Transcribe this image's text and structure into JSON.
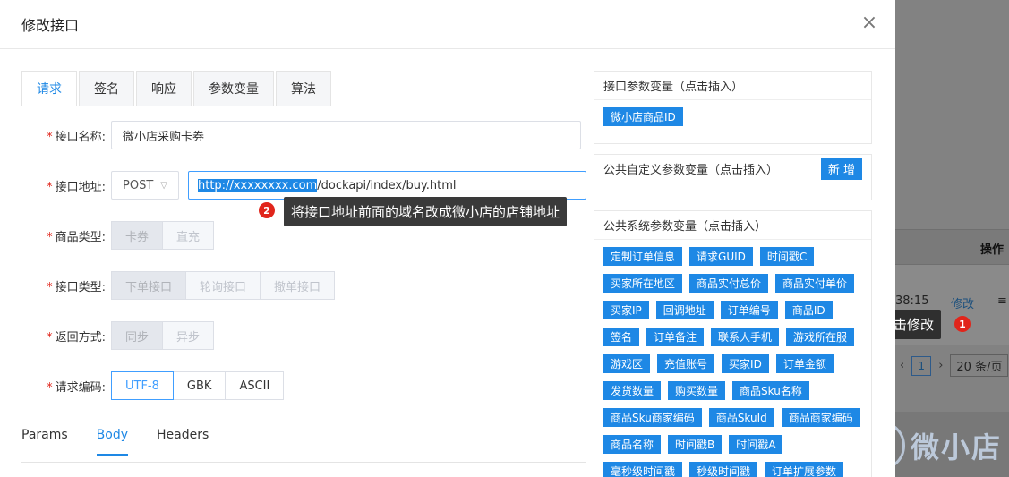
{
  "dialog": {
    "title": "修改接口",
    "close_icon": "×"
  },
  "tabs": [
    {
      "label": "请求",
      "active": true
    },
    {
      "label": "签名"
    },
    {
      "label": "响应"
    },
    {
      "label": "参数变量"
    },
    {
      "label": "算法"
    }
  ],
  "form": {
    "name": {
      "label": "接口名称:",
      "value": "微小店采购卡券"
    },
    "url": {
      "label": "接口地址:",
      "method": "POST",
      "domain": "http://xxxxxxxx.com",
      "path": "/dockapi/index/buy.html"
    },
    "goods_type": {
      "label": "商品类型:",
      "options": [
        "卡券",
        "直充"
      ]
    },
    "api_type": {
      "label": "接口类型:",
      "options": [
        "下单接口",
        "轮询接口",
        "撤单接口"
      ]
    },
    "return_mode": {
      "label": "返回方式:",
      "options": [
        "同步",
        "异步"
      ]
    },
    "encoding": {
      "label": "请求编码:",
      "options": [
        "UTF-8",
        "GBK",
        "ASCII"
      ]
    }
  },
  "subtabs": [
    {
      "label": "Params"
    },
    {
      "label": "Body",
      "active": true
    },
    {
      "label": "Headers"
    }
  ],
  "hint2": {
    "badge": "2",
    "text": "将接口地址前面的域名改成微小店的店铺地址"
  },
  "hint1": {
    "badge": "1",
    "text": "点击修改"
  },
  "panels": {
    "interface_params": {
      "title": "接口参数变量（点击插入）",
      "chips": [
        "微小店商品ID"
      ]
    },
    "public_custom": {
      "title": "公共自定义参数变量（点击插入）",
      "add_label": "新 增"
    },
    "public_system": {
      "title": "公共系统参数变量（点击插入）",
      "chips": [
        "定制订单信息",
        "请求GUID",
        "时间戳C",
        "买家所在地区",
        "商品实付总价",
        "商品实付单价",
        "买家IP",
        "回调地址",
        "订单编号",
        "商品ID",
        "签名",
        "订单备注",
        "联系人手机",
        "游戏所在服",
        "游戏区",
        "充值账号",
        "买家ID",
        "订单金额",
        "发货数量",
        "购买数量",
        "商品Sku名称",
        "商品Sku商家编码",
        "商品SkuId",
        "商品商家编码",
        "商品名称",
        "时间戳B",
        "时间戳A",
        "毫秒级时间戳",
        "秒级时间戳",
        "订单扩展参数"
      ]
    }
  },
  "background": {
    "op_header": "操作",
    "time": "38:15",
    "modify": "修改",
    "more_icon": "≡",
    "page": "1",
    "page_size": "20 条/页",
    "prev": "‹",
    "next": "›"
  },
  "watermark": {
    "title": "微小店"
  }
}
